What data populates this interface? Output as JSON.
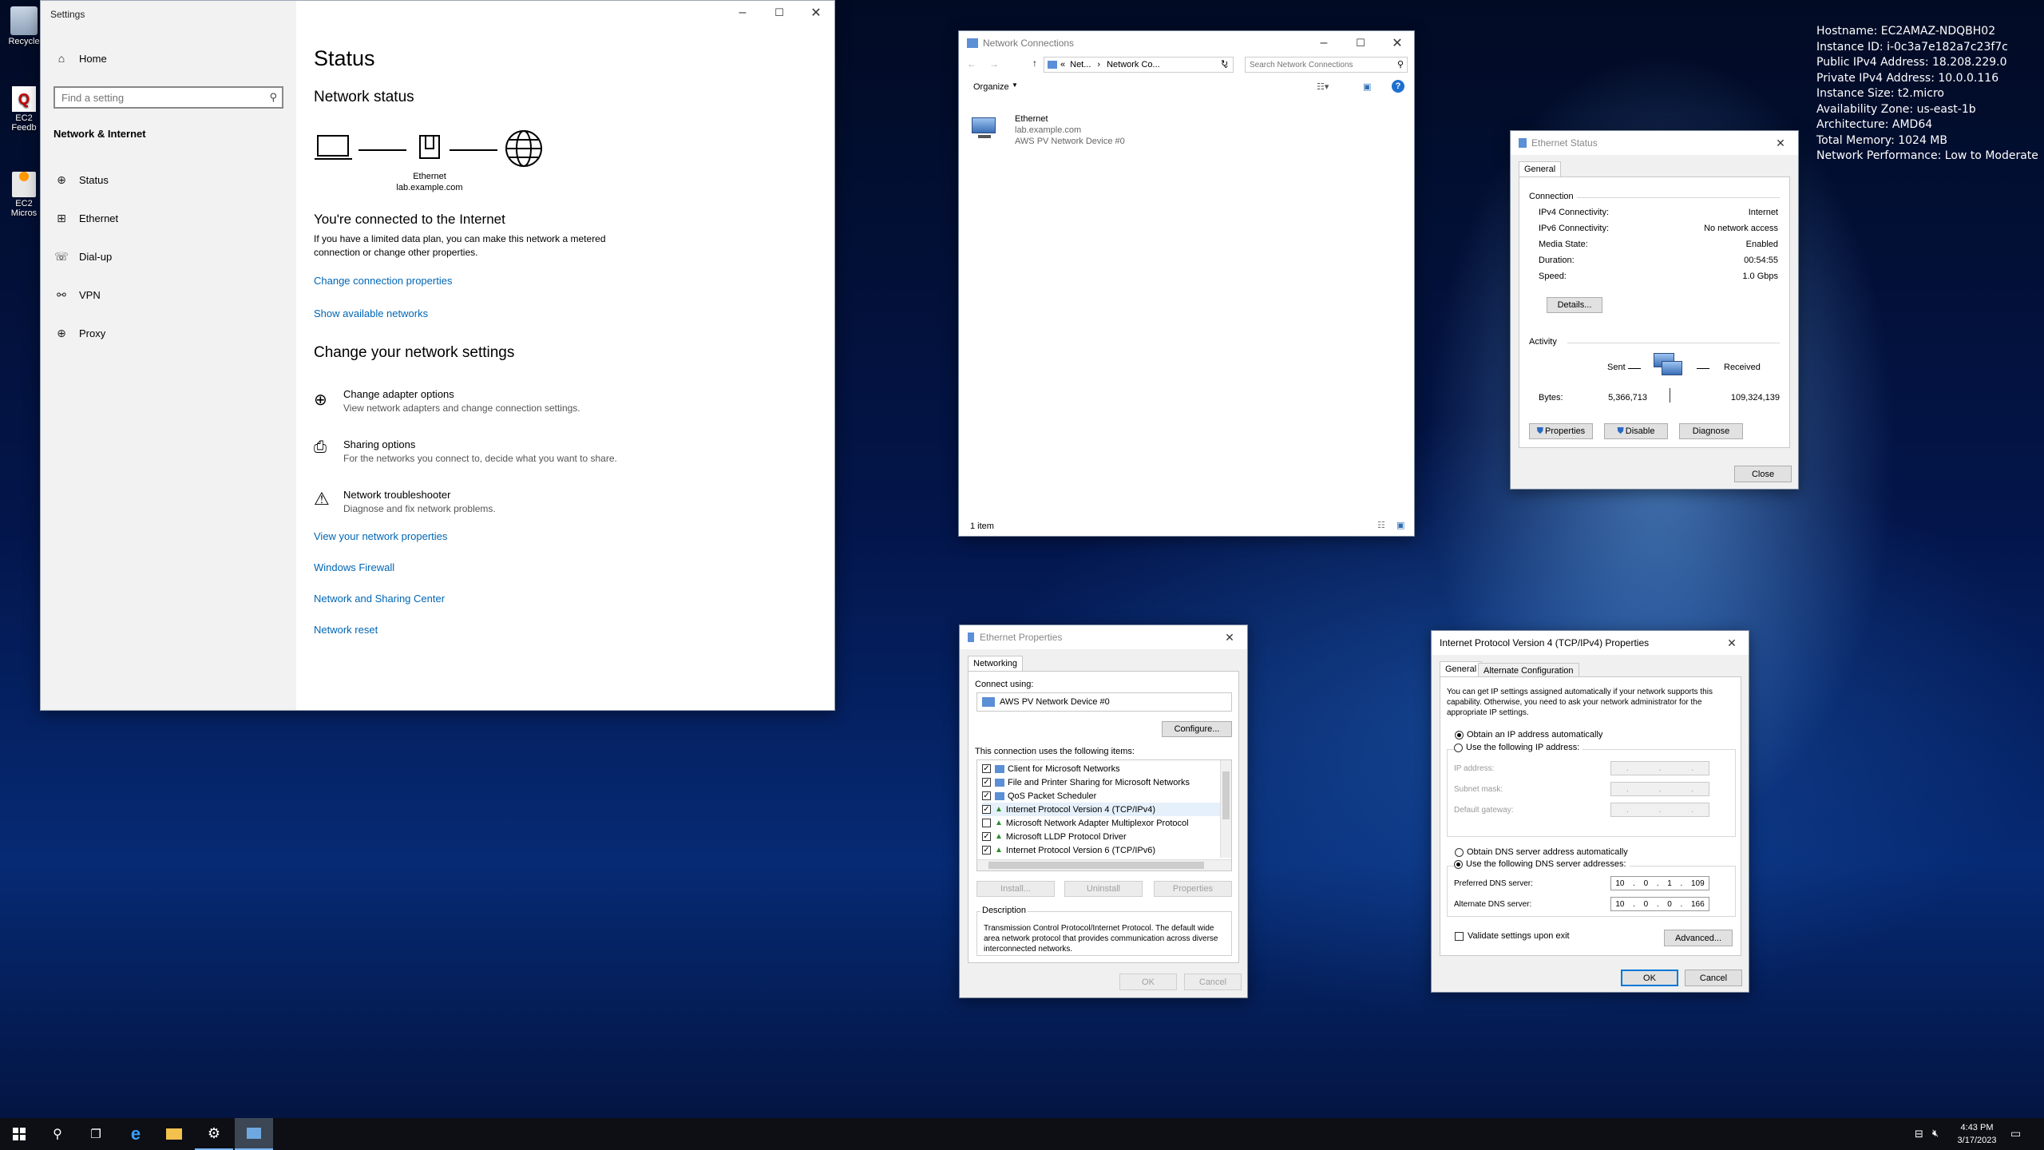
{
  "desktop": {
    "icons": [
      {
        "label": "Recycle"
      },
      {
        "label": "EC2 Feedb"
      },
      {
        "label": "EC2 Micros"
      }
    ],
    "info": [
      "Hostname: EC2AMAZ-NDQBH02",
      "Instance ID: i-0c3a7e182a7c23f7c",
      "Public IPv4 Address: 18.208.229.0",
      "Private IPv4 Address: 10.0.0.116",
      "Instance Size: t2.micro",
      "Availability Zone: us-east-1b",
      "Architecture: AMD64",
      "Total Memory: 1024 MB",
      "Network Performance: Low to Moderate"
    ]
  },
  "settings": {
    "title": "Settings",
    "home": "Home",
    "search_placeholder": "Find a setting",
    "category": "Network & Internet",
    "nav": [
      "Status",
      "Ethernet",
      "Dial-up",
      "VPN",
      "Proxy"
    ],
    "page_title": "Status",
    "network_status": "Network status",
    "diagram_label": "Ethernet",
    "diagram_sublabel": "lab.example.com",
    "connected": "You're connected to the Internet",
    "connected_desc": "If you have a limited data plan, you can make this network a metered connection or change other properties.",
    "change_props": "Change connection properties",
    "show_networks": "Show available networks",
    "change_heading": "Change your network settings",
    "options": [
      {
        "title": "Change adapter options",
        "desc": "View network adapters and change connection settings."
      },
      {
        "title": "Sharing options",
        "desc": "For the networks you connect to, decide what you want to share."
      },
      {
        "title": "Network troubleshooter",
        "desc": "Diagnose and fix network problems."
      }
    ],
    "links": [
      "View your network properties",
      "Windows Firewall",
      "Network and Sharing Center",
      "Network reset"
    ]
  },
  "netconn": {
    "title": "Network Connections",
    "crumb1": "Net...",
    "crumb2": "Network Co...",
    "search_placeholder": "Search Network Connections",
    "organize": "Organize",
    "item_name": "Ethernet",
    "item_domain": "lab.example.com",
    "item_device": "AWS PV Network Device #0",
    "status_bar": "1 item"
  },
  "eth_status": {
    "title": "Ethernet Status",
    "tab": "General",
    "connection": "Connection",
    "fields": [
      {
        "k": "IPv4 Connectivity:",
        "v": "Internet"
      },
      {
        "k": "IPv6 Connectivity:",
        "v": "No network access"
      },
      {
        "k": "Media State:",
        "v": "Enabled"
      },
      {
        "k": "Duration:",
        "v": "00:54:55"
      },
      {
        "k": "Speed:",
        "v": "1.0 Gbps"
      }
    ],
    "details": "Details...",
    "activity": "Activity",
    "sent": "Sent",
    "received": "Received",
    "bytes": "Bytes:",
    "bytes_sent": "5,366,713",
    "bytes_received": "109,324,139",
    "properties": "Properties",
    "disable": "Disable",
    "diagnose": "Diagnose",
    "close": "Close"
  },
  "eth_props": {
    "title": "Ethernet Properties",
    "tab": "Networking",
    "connect_using": "Connect using:",
    "device": "AWS PV Network Device #0",
    "configure": "Configure...",
    "items_label": "This connection uses the following items:",
    "items": [
      {
        "label": "Client for Microsoft Networks",
        "checked": "✓"
      },
      {
        "label": "File and Printer Sharing for Microsoft Networks",
        "checked": "✓"
      },
      {
        "label": "QoS Packet Scheduler",
        "checked": "✓"
      },
      {
        "label": "Internet Protocol Version 4 (TCP/IPv4)",
        "checked": "✓"
      },
      {
        "label": "Microsoft Network Adapter Multiplexor Protocol",
        "checked": ""
      },
      {
        "label": "Microsoft LLDP Protocol Driver",
        "checked": "✓"
      },
      {
        "label": "Internet Protocol Version 6 (TCP/IPv6)",
        "checked": "✓"
      }
    ],
    "install": "Install...",
    "uninstall": "Uninstall",
    "properties": "Properties",
    "description_label": "Description",
    "description": "Transmission Control Protocol/Internet Protocol. The default wide area network protocol that provides communication across diverse interconnected networks.",
    "ok": "OK",
    "cancel": "Cancel"
  },
  "ipv4": {
    "title": "Internet Protocol Version 4 (TCP/IPv4) Properties",
    "tab_general": "General",
    "tab_alt": "Alternate Configuration",
    "intro": "You can get IP settings assigned automatically if your network supports this capability. Otherwise, you need to ask your network administrator for the appropriate IP settings.",
    "obtain_ip": "Obtain an IP address automatically",
    "use_ip": "Use the following IP address:",
    "ip_address": "IP address:",
    "subnet": "Subnet mask:",
    "gateway": "Default gateway:",
    "obtain_dns": "Obtain DNS server address automatically",
    "use_dns": "Use the following DNS server addresses:",
    "pref_dns": "Preferred DNS server:",
    "alt_dns": "Alternate DNS server:",
    "pref_dns_value": [
      "10",
      "0",
      "1",
      "109"
    ],
    "alt_dns_value": [
      "10",
      "0",
      "0",
      "166"
    ],
    "validate": "Validate settings upon exit",
    "advanced": "Advanced...",
    "ok": "OK",
    "cancel": "Cancel"
  },
  "taskbar": {
    "time": "4:43 PM",
    "date": "3/17/2023"
  }
}
